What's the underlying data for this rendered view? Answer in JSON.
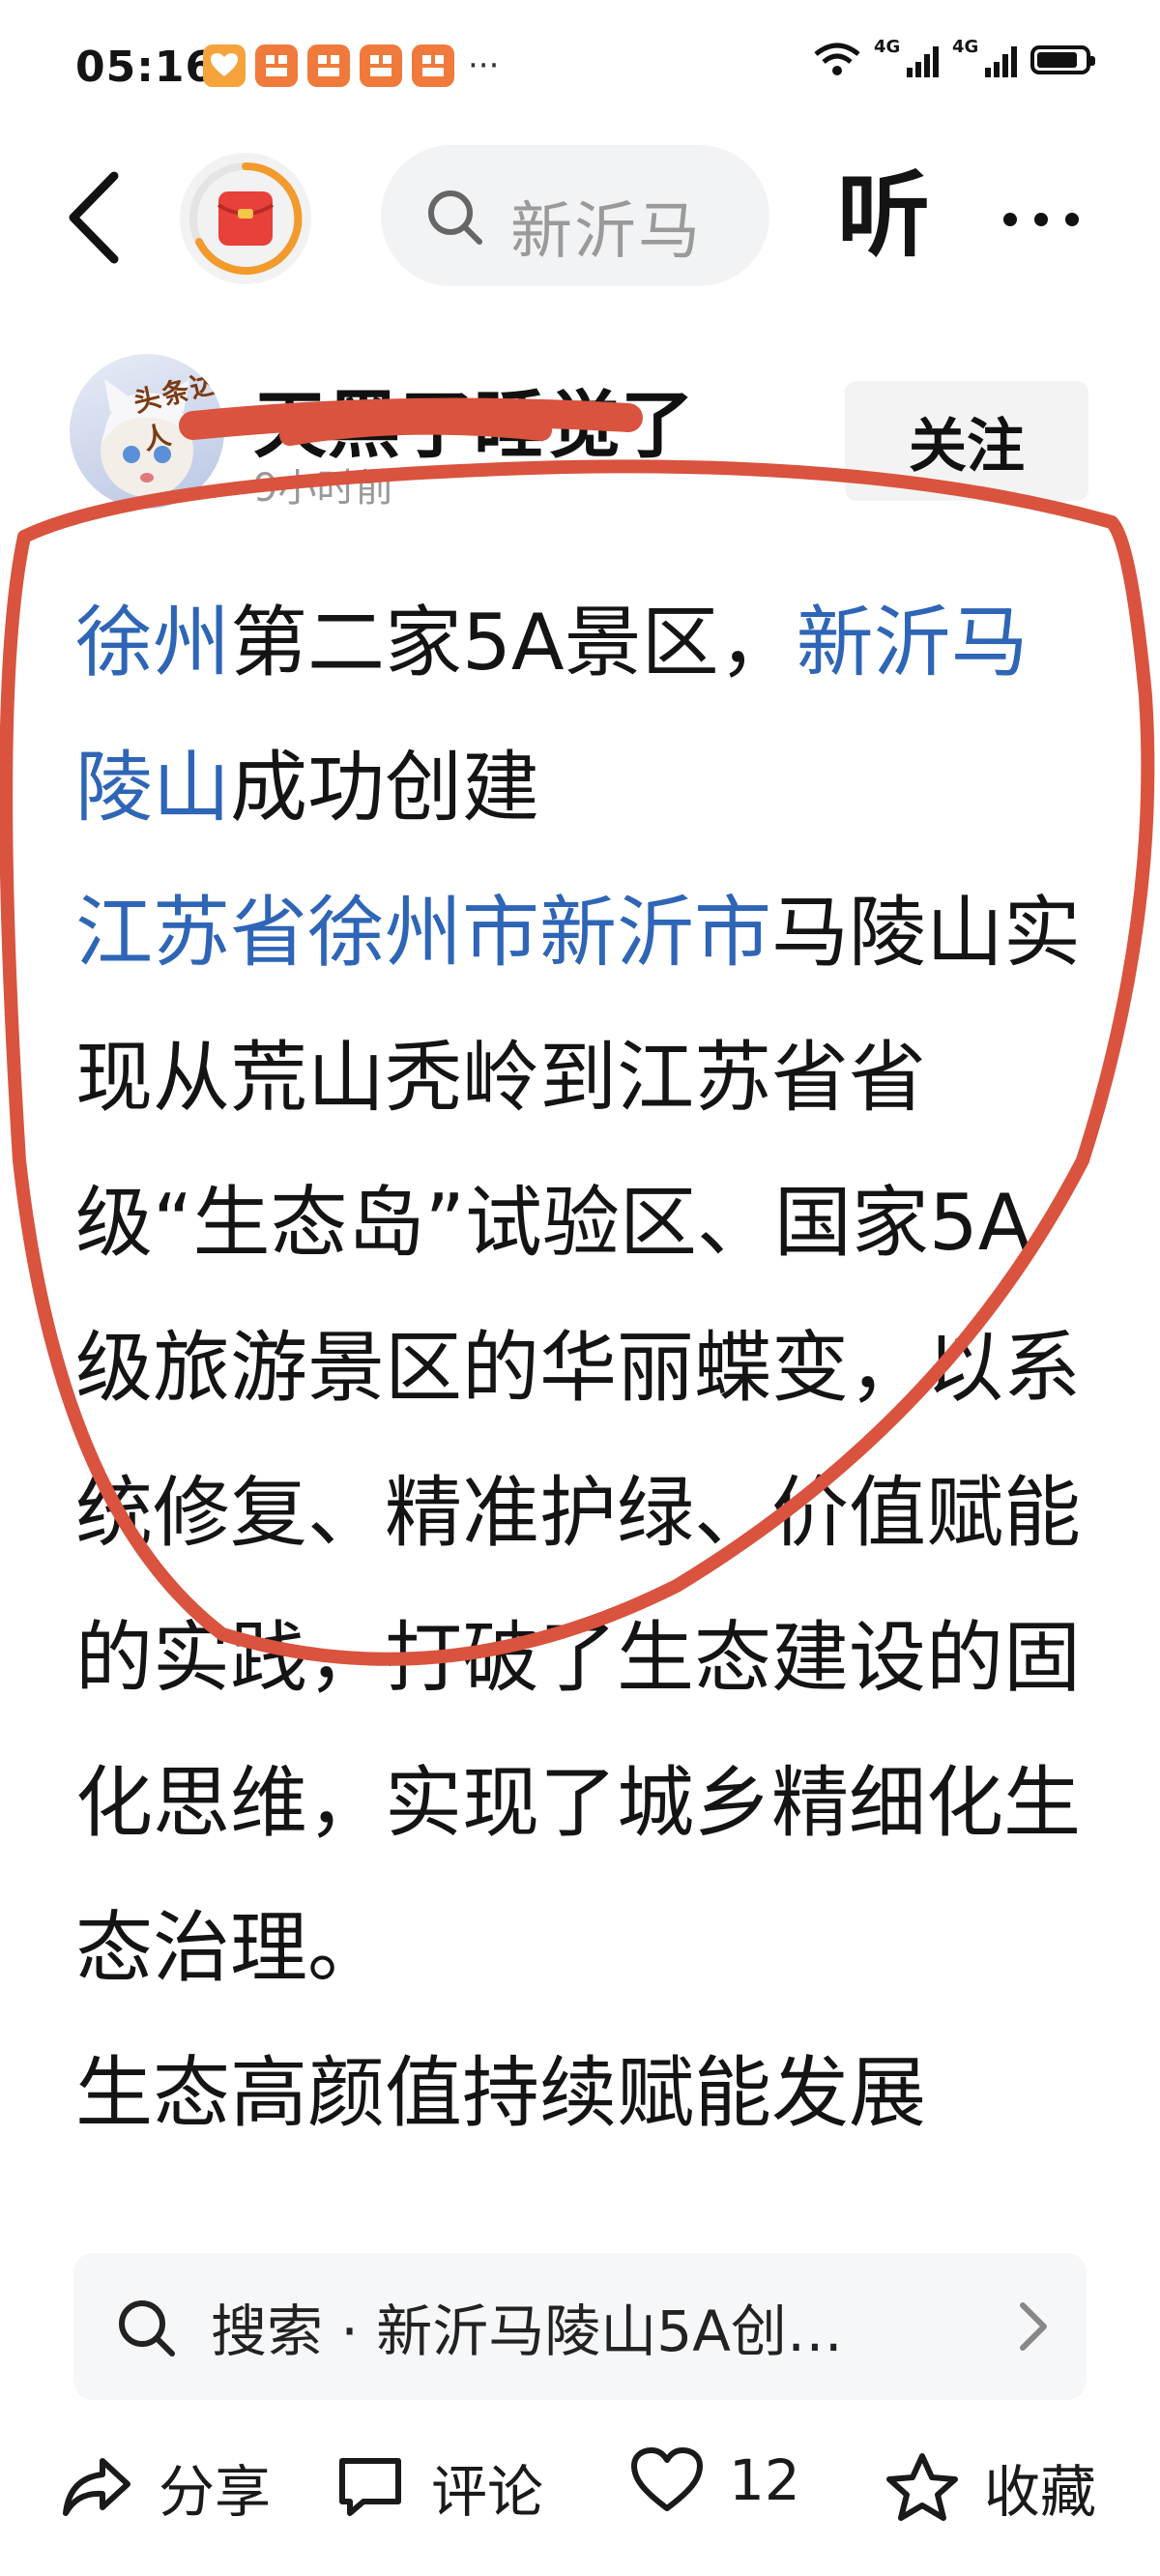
{
  "status_bar": {
    "time": "05:16",
    "more": "···",
    "network_1": "4G",
    "network_2": "4G"
  },
  "top_nav": {
    "search_placeholder": "新沂马",
    "listen_label": "听"
  },
  "author": {
    "name": "天黑了睡觉了",
    "time_ago": "9小时前",
    "avatar_tag": "头条达人",
    "follow_label": "关注"
  },
  "article": {
    "p1": {
      "kw1": "徐州",
      "t1": "第二家5A景区，",
      "kw2": "新沂马陵山",
      "t2": "成功创建"
    },
    "p2": {
      "kw1": "江苏省徐州市新沂市",
      "t1": "马陵山实现从荒山秃岭到江苏省省级“生态岛”试验区、国家5A级旅游景区的华丽蝶变，以系统修复、精准护绿、价值赋能的实践，打破了生态建设的固化思维，实现了城乡精细化生态治理。"
    },
    "p3": "生态高颜值持续赋能发展"
  },
  "search_suggest": {
    "text": "搜索 · 新沂马陵山5A创…"
  },
  "actions": {
    "share": "分享",
    "comment": "评论",
    "like_count": "12",
    "favorite": "收藏"
  },
  "colors": {
    "keyword": "#2e65b6",
    "annotation_red": "#d9533e",
    "icon_orange": "#f07a3c"
  }
}
